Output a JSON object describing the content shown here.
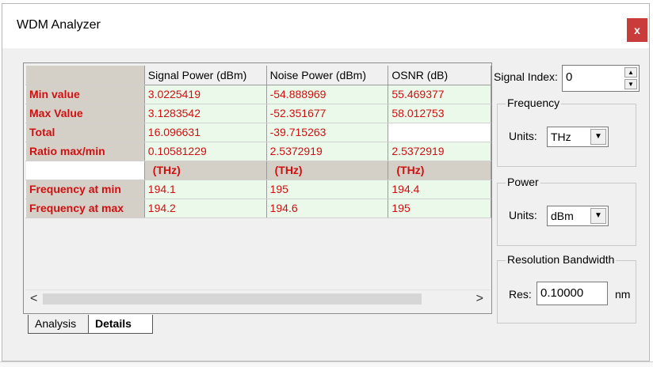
{
  "window": {
    "title": "WDM Analyzer",
    "close_label": "x"
  },
  "table": {
    "columns": [
      "Signal Power (dBm)",
      "Noise Power (dBm)",
      "OSNR (dB)"
    ],
    "rows": [
      {
        "label": "Min value",
        "values": [
          "3.0225419",
          "-54.888969",
          "55.469377"
        ]
      },
      {
        "label": "Max Value",
        "values": [
          "3.1283542",
          "-52.351677",
          "58.012753"
        ]
      },
      {
        "label": "Total",
        "values": [
          "16.096631",
          "-39.715263",
          ""
        ]
      },
      {
        "label": "Ratio max/min",
        "values": [
          "0.10581229",
          "2.5372919",
          "2.5372919"
        ]
      }
    ],
    "unit_row": [
      "(THz)",
      "(THz)",
      "(THz)"
    ],
    "freq_rows": [
      {
        "label": "Frequency at min",
        "values": [
          "194.1",
          "195",
          "194.4"
        ]
      },
      {
        "label": "Frequency at max",
        "values": [
          "194.2",
          "194.6",
          "195"
        ]
      }
    ]
  },
  "scroll": {
    "left_arrow": "<",
    "right_arrow": ">"
  },
  "tabs": [
    {
      "label": "Analysis"
    },
    {
      "label": "Details"
    }
  ],
  "signal_index": {
    "label": "Signal Index:",
    "value": "0"
  },
  "frequency": {
    "group_label": "Frequency",
    "units_label": "Units:",
    "units_value": "THz"
  },
  "power": {
    "group_label": "Power",
    "units_label": "Units:",
    "units_value": "dBm"
  },
  "resolution": {
    "group_label": "Resolution Bandwidth",
    "res_label": "Res:",
    "res_value": "0.10000",
    "unit": "nm"
  }
}
